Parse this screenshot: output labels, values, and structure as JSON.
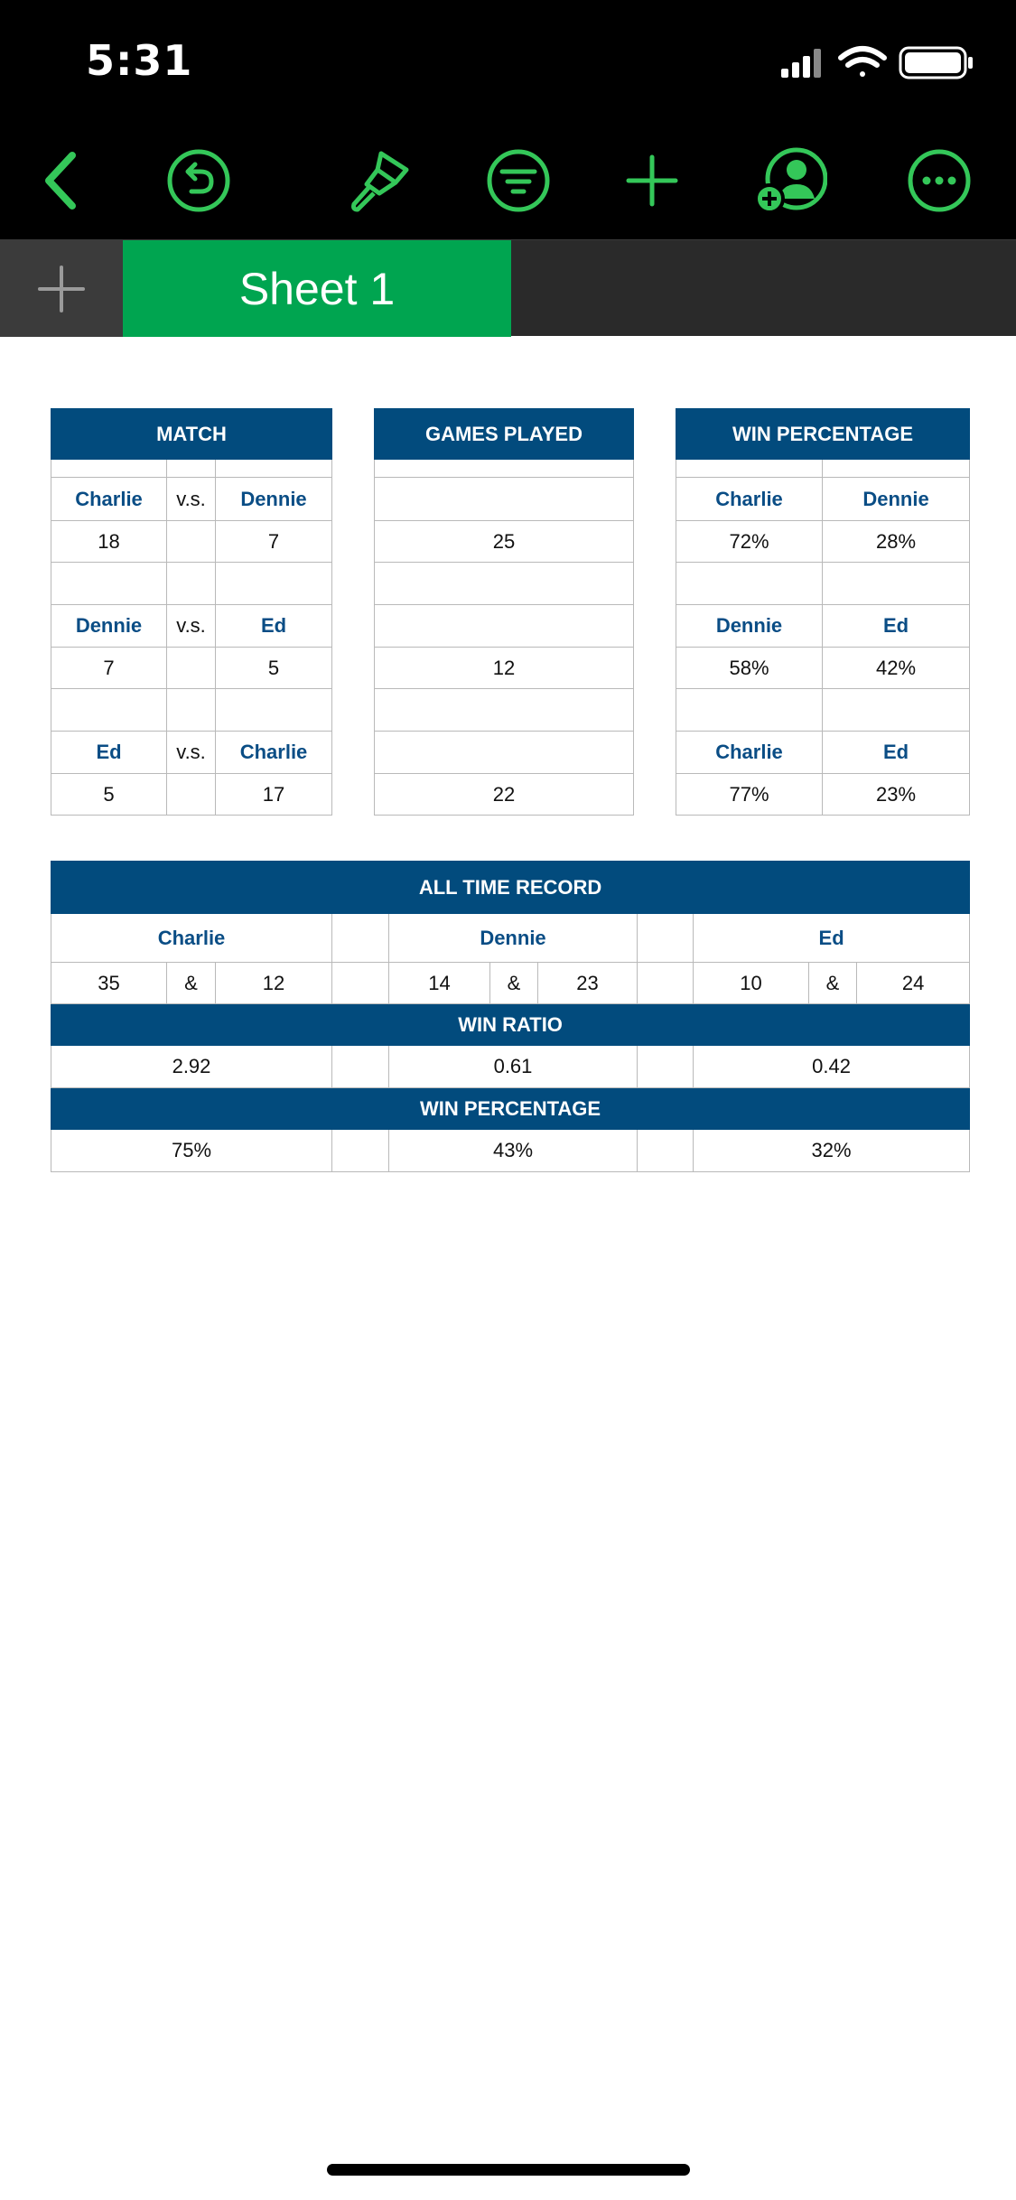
{
  "status_bar": {
    "time": "5:31"
  },
  "toolbar": {
    "icons": [
      "back-chevron-icon",
      "undo-icon",
      "paintbrush-icon",
      "filter-icon",
      "add-icon",
      "collaborate-icon",
      "more-icon"
    ],
    "accent_color": "#34c759"
  },
  "tabs": {
    "add_symbol": "+",
    "sheet_name": "Sheet 1",
    "active_color": "#00a550"
  },
  "colors": {
    "header_blue": "#024b7d",
    "name_blue": "#0a4d85"
  },
  "match": {
    "title": "MATCH",
    "rows": [
      {
        "left": "Charlie",
        "vs": "v.s.",
        "right": "Dennie",
        "left_score": "18",
        "right_score": "7"
      },
      {
        "left": "Dennie",
        "vs": "v.s.",
        "right": "Ed",
        "left_score": "7",
        "right_score": "5"
      },
      {
        "left": "Ed",
        "vs": "v.s.",
        "right": "Charlie",
        "left_score": "5",
        "right_score": "17"
      }
    ]
  },
  "games_played": {
    "title": "GAMES PLAYED",
    "values": [
      "25",
      "12",
      "22"
    ]
  },
  "win_percentage": {
    "title": "WIN PERCENTAGE",
    "rows": [
      {
        "left": "Charlie",
        "right": "Dennie",
        "left_pct": "72%",
        "right_pct": "28%"
      },
      {
        "left": "Dennie",
        "right": "Ed",
        "left_pct": "58%",
        "right_pct": "42%"
      },
      {
        "left": "Charlie",
        "right": "Ed",
        "left_pct": "77%",
        "right_pct": "23%"
      }
    ]
  },
  "all_time": {
    "title": "ALL TIME RECORD",
    "players": [
      {
        "name": "Charlie",
        "wins": "35",
        "amp": "&",
        "losses": "12",
        "ratio": "2.92",
        "pct": "75%"
      },
      {
        "name": "Dennie",
        "wins": "14",
        "amp": "&",
        "losses": "23",
        "ratio": "0.61",
        "pct": "43%"
      },
      {
        "name": "Ed",
        "wins": "10",
        "amp": "&",
        "losses": "24",
        "ratio": "0.42",
        "pct": "32%"
      }
    ],
    "win_ratio_label": "WIN RATIO",
    "win_pct_label": "WIN PERCENTAGE"
  }
}
